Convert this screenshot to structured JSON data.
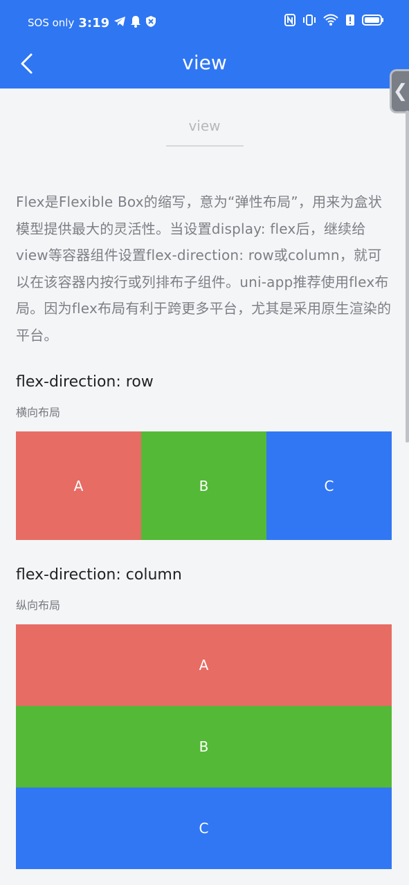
{
  "status_bar": {
    "sos_text": "SOS only",
    "time": "3:19"
  },
  "navbar": {
    "title": "view"
  },
  "page_head": {
    "label": "view"
  },
  "intro_text": "Flex是Flexible Box的缩写，意为“弹性布局”，用来为盒状模型提供最大的灵活性。当设置display: flex后，继续给view等容器组件设置flex-direction: row或column，就可以在该容器内按行或列排布子组件。uni-app推荐使用flex布局。因为flex布局有利于跨更多平台，尤其是采用原生渲染的平台。",
  "section_row": {
    "title": "flex-direction: row",
    "subtitle": "横向布局",
    "cells": [
      "A",
      "B",
      "C"
    ]
  },
  "section_column": {
    "title": "flex-direction: column",
    "subtitle": "纵向布局",
    "cells": [
      "A",
      "B",
      "C"
    ]
  },
  "colors": {
    "header_blue": "#2f76f2",
    "red": "#e76c64",
    "green": "#54b936",
    "blue": "#3177f3"
  },
  "icons": {
    "back": "chevron-left-icon",
    "side_tab": "chevron-left-icon"
  }
}
